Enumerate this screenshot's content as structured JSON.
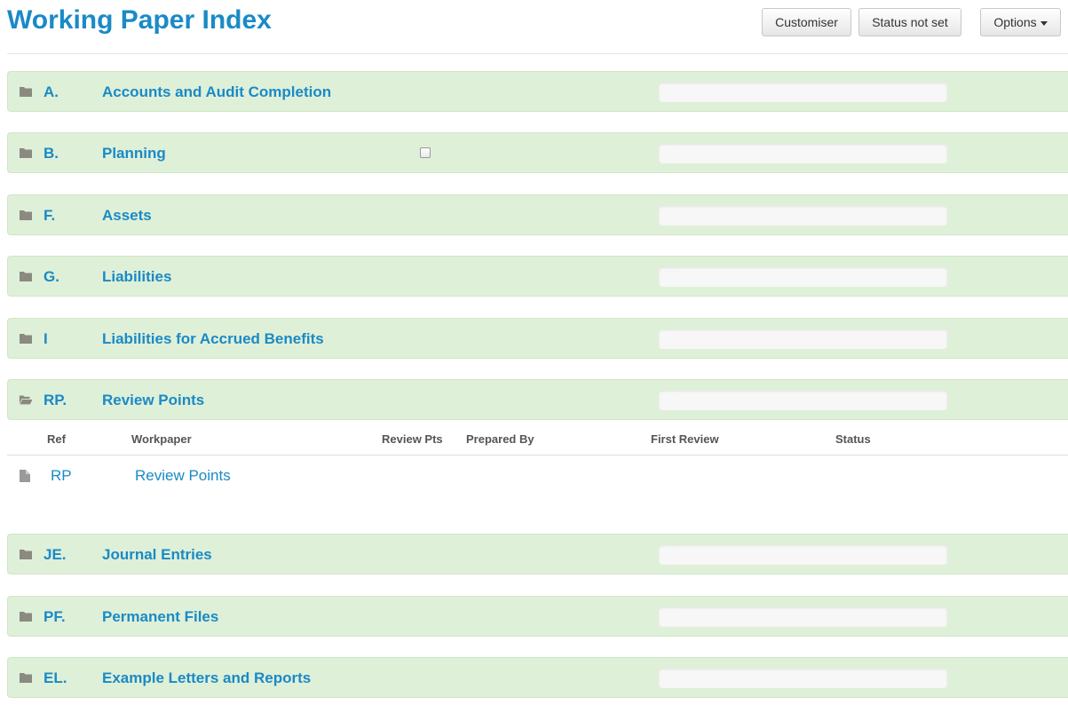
{
  "header": {
    "title": "Working Paper Index",
    "customiser_label": "Customiser",
    "status_label": "Status not set",
    "options_label": "Options"
  },
  "sections": [
    {
      "ref": "A.",
      "name": "Accounts and Audit Completion",
      "progress": "0%",
      "progress_value": 0
    },
    {
      "ref": "B.",
      "name": "Planning",
      "progress": "0%",
      "progress_value": 0
    },
    {
      "ref": "F.",
      "name": "Assets",
      "progress": "0%",
      "progress_value": 0
    },
    {
      "ref": "G.",
      "name": "Liabilities",
      "progress": "0%",
      "progress_value": 0
    },
    {
      "ref": "I",
      "name": "Liabilities for Accrued Benefits",
      "progress": "0%",
      "progress_value": 0
    },
    {
      "ref": "RP.",
      "name": "Review Points",
      "progress": "0%",
      "progress_value": 0,
      "expanded": true
    },
    {
      "ref": "JE.",
      "name": "Journal Entries",
      "progress": "0%",
      "progress_value": 0
    },
    {
      "ref": "PF.",
      "name": "Permanent Files",
      "progress": "0%",
      "progress_value": 0
    },
    {
      "ref": "EL.",
      "name": "Example Letters and Reports",
      "progress": "0%",
      "progress_value": 0
    }
  ],
  "workpaper_table": {
    "columns": [
      "Ref",
      "Workpaper",
      "Review Pts",
      "Prepared By",
      "First Review",
      "Status"
    ],
    "rows": [
      {
        "ref": "RP",
        "workpaper": "Review Points"
      }
    ]
  },
  "icons": {
    "folder": "folder-icon",
    "folder_open": "folder-open-icon",
    "file": "file-icon",
    "caret": "caret-down-icon"
  },
  "colors": {
    "accent": "#1a8ac6",
    "section_bg": "#dff0d8",
    "icon": "#8a8a80"
  }
}
